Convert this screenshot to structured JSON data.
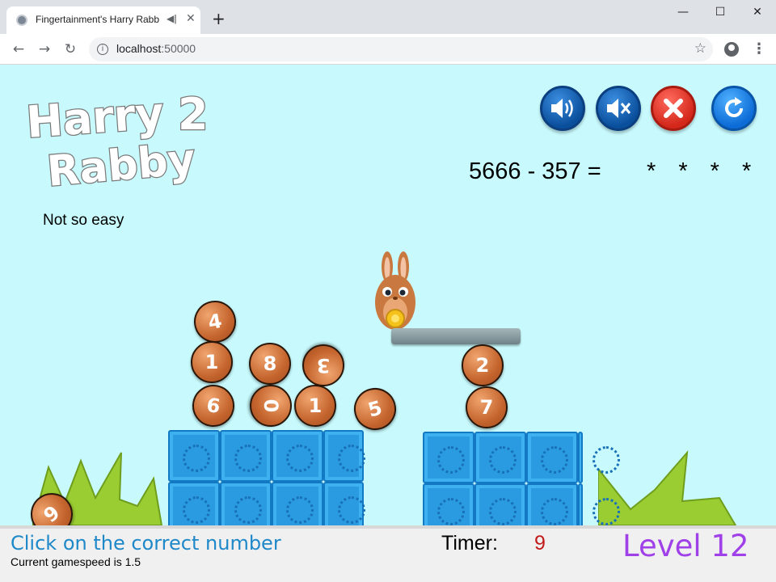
{
  "browser": {
    "tab_title": "Fingertainment's Harry Rabb",
    "tab_audio_icon": "speaker-icon",
    "new_tab": "+",
    "url_host": "localhost",
    "url_port": ":50000",
    "window_controls": {
      "minimize": "—",
      "maximize": "☐",
      "close": "✕"
    }
  },
  "game": {
    "logo": {
      "line1": "Harry",
      "number": "2",
      "line2": "Rabby"
    },
    "difficulty": "Not so easy",
    "equation": "5666 - 357 =",
    "answer_mask": "* * * *",
    "controls": [
      "sound-on-icon",
      "mute-icon",
      "close-icon",
      "restart-icon"
    ],
    "balls": [
      {
        "id": "ball-1",
        "label": "4"
      },
      {
        "id": "ball-2",
        "label": "1"
      },
      {
        "id": "ball-3",
        "label": "8"
      },
      {
        "id": "ball-4",
        "label": "3"
      },
      {
        "id": "ball-5",
        "label": "6"
      },
      {
        "id": "ball-6",
        "label": "0"
      },
      {
        "id": "ball-7",
        "label": "1"
      },
      {
        "id": "ball-8",
        "label": "5"
      },
      {
        "id": "ball-9",
        "label": "2"
      },
      {
        "id": "ball-10",
        "label": "7"
      },
      {
        "id": "ball-11",
        "label": "9"
      }
    ]
  },
  "footer": {
    "instruction": "Click on the correct number",
    "speed": "Current gamespeed is 1.5",
    "timer_label": "Timer:",
    "timer_value": "9",
    "level": "Level 12"
  },
  "colors": {
    "sky": "#c8fafd",
    "crate": "#2a9be0",
    "ball": "#c5652e",
    "level": "#a040e8",
    "instruction": "#1e88c9",
    "timer": "#c31a1a"
  }
}
